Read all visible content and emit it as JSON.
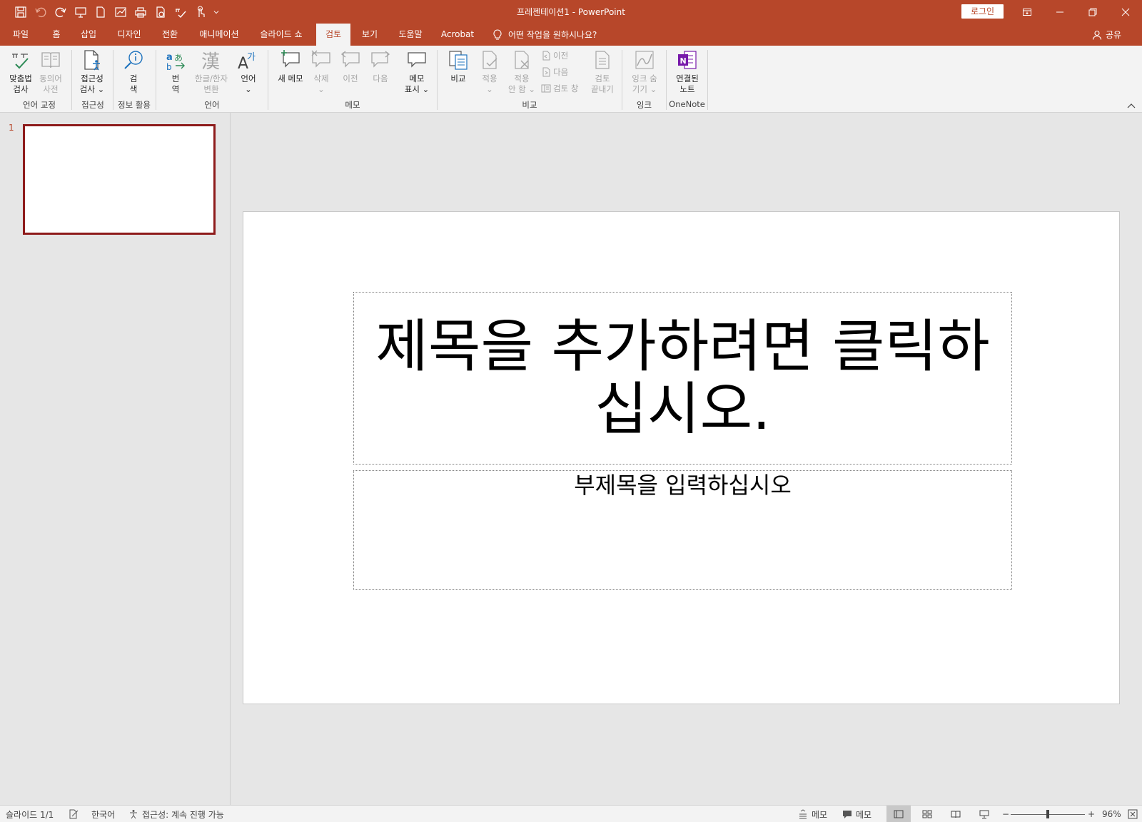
{
  "window": {
    "title": "프레젠테이션1  -  PowerPoint",
    "login_label": "로그인"
  },
  "qat_icons": [
    "save-icon",
    "undo-icon",
    "redo-icon",
    "present-icon",
    "new-doc-icon",
    "chart-icon",
    "print-icon",
    "pdf-icon",
    "spelling-icon",
    "touch-mode-icon",
    "customize-qat-icon"
  ],
  "tabs": [
    {
      "label": "파일",
      "active": false
    },
    {
      "label": "홈",
      "active": false
    },
    {
      "label": "삽입",
      "active": false
    },
    {
      "label": "디자인",
      "active": false
    },
    {
      "label": "전환",
      "active": false
    },
    {
      "label": "애니메이션",
      "active": false
    },
    {
      "label": "슬라이드 쇼",
      "active": false
    },
    {
      "label": "검토",
      "active": true
    },
    {
      "label": "보기",
      "active": false
    },
    {
      "label": "도움말",
      "active": false
    },
    {
      "label": "Acrobat",
      "active": false
    }
  ],
  "tell_me": "어떤 작업을 원하시나요?",
  "share_label": "공유",
  "ribbon": {
    "spelling": "맞춤법\n검사",
    "thesaurus": "동의어\n사전",
    "accessibility": "접근성\n검사 ⌄",
    "search": "검\n색",
    "translate": "번\n역",
    "hanja": "한글/한자\n변환",
    "language": "언어\n⌄",
    "new_comment": "새 메모",
    "delete_comment": "삭제\n⌄",
    "prev_comment": "이전",
    "next_comment": "다음",
    "show_comments": "메모\n표시 ⌄",
    "compare": "비교",
    "accept": "적용\n⌄",
    "reject": "적용\n안 함 ⌄",
    "prev_change": "이전",
    "next_change": "다음",
    "review_pane": "검토 창",
    "end_review": "검토\n끝내기",
    "hide_ink": "잉크 숨\n기기 ⌄",
    "linked_notes": "연결된\n노트",
    "groups": {
      "proofing": "언어 교정",
      "accessibility": "접근성",
      "insights": "정보 활용",
      "language": "언어",
      "comments": "메모",
      "compare": "비교",
      "ink": "잉크",
      "onenote": "OneNote"
    }
  },
  "thumbnails": [
    {
      "number": "1"
    }
  ],
  "slide": {
    "title_placeholder": "제목을 추가하려면 클릭하십시오.",
    "subtitle_placeholder": "부제목을 입력하십시오"
  },
  "status": {
    "slide_indicator": "슬라이드 1/1",
    "language": "한국어",
    "accessibility": "접근성: 계속 진행 가능",
    "notes_label": "메모",
    "comments_label": "메모",
    "zoom_percent": "96%",
    "zoom_level": 0.5
  },
  "colors": {
    "accent": "#b7472a",
    "ribbon_bg": "#f3f3f3",
    "workspace_bg": "#e6e6e6",
    "thumb_border": "#8e1b1b"
  }
}
